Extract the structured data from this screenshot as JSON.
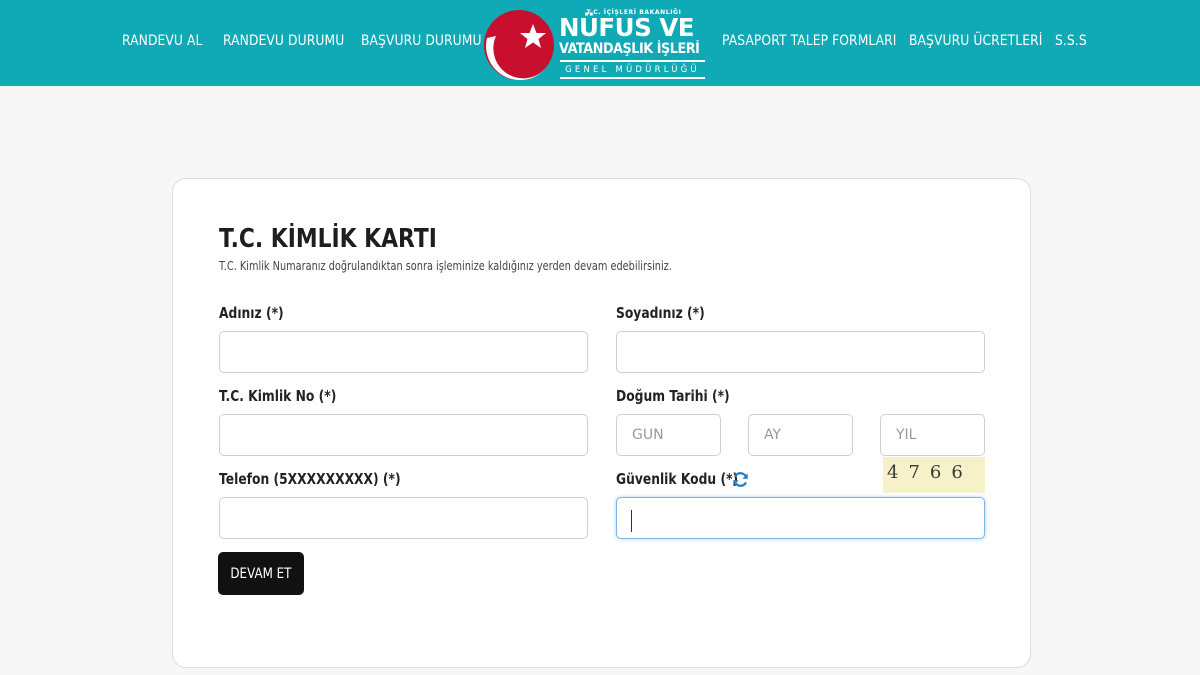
{
  "nav": {
    "left": [
      "RANDEVU AL",
      "RANDEVU DURUMU",
      "BAŞVURU DURUMU"
    ],
    "right": [
      "PASAPORT TALEP FORMLARI",
      "BAŞVURU ÜCRETLERİ",
      "S.S.S"
    ]
  },
  "logo": {
    "top_line": "T.C. İÇİŞLERİ BAKANLIĞI",
    "line1": "NÜFUS VE",
    "line2": "VATANDAŞLIK İŞLERİ",
    "line3": "GENEL MÜDÜRLÜĞÜ"
  },
  "form": {
    "title": "T.C. KİMLİK KARTI",
    "subtitle": "T.C. Kimlik Numaranız doğrulandıktan sonra işleminize kaldığınız yerden devam edebilirsiniz.",
    "name_label": "Adınız (*)",
    "surname_label": "Soyadınız (*)",
    "tc_label": "T.C. Kimlik No (*)",
    "birth_label": "Doğum Tarihi (*)",
    "day_placeholder": "GÜN",
    "month_placeholder": "AY",
    "year_placeholder": "YIL",
    "phone_label": "Telefon (5XXXXXXXXX) (*)",
    "security_label": "Güvenlik Kodu (*)",
    "captcha_code": "4766",
    "submit_label": "DEVAM ET"
  },
  "colors": {
    "header": "#10aab6",
    "logo_crescent": "#c8102e",
    "button": "#111111",
    "captcha_bg": "#f6f1c8"
  },
  "icons": [
    "refresh-icon"
  ]
}
